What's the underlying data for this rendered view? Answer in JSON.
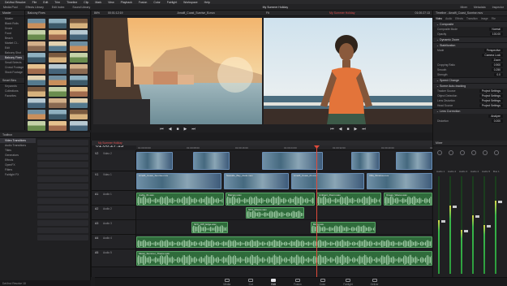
{
  "app": {
    "name": "DaVinci Resolve",
    "project_title": "My Summer Holiday",
    "footer": "DaVinci Resolve 18"
  },
  "menu": [
    "DaVinci Resolve",
    "File",
    "Edit",
    "Trim",
    "Timeline",
    "Clip",
    "Mark",
    "View",
    "Playback",
    "Fusion",
    "Color",
    "Fairlight",
    "Workspace",
    "Help"
  ],
  "toolbar": {
    "left": [
      "Media Pool",
      "Effects Library",
      "Edit Index",
      "Sound Library"
    ],
    "right": [
      "Mixer",
      "Metadata",
      "Inspector"
    ]
  },
  "media_pool": {
    "title": "Balcony Fixes",
    "sidebar_header": "Master",
    "sidebar_items": [
      "Master",
      "Black Rolls",
      "Drone",
      "Food",
      "Beach",
      "Market Cl...",
      "Edit",
      "Balcony Shot",
      "Balcony Fixes",
      "Small Selects",
      "Crowd Footage",
      "Stock Footage"
    ],
    "smart_bins_header": "Smart Bins",
    "smart_bins": [
      "Keywords",
      "Collections",
      "Favorites"
    ],
    "thumb_count": 30
  },
  "viewer_left": {
    "zoom": "86%",
    "timecode": "00:01:12:19",
    "clip_name": "Amalfi_Coast_Sunrise_B.mov",
    "playhead": "00:01:27:13"
  },
  "viewer_right": {
    "timeline_name": "My Summer Holiday",
    "zoom": "Fit",
    "timecode": "01:00:27:13"
  },
  "inspector": {
    "clip_name": "Timeline - Amalfi_Coast_Sunrise.mov",
    "tabs": [
      "Video",
      "Audio",
      "Effects",
      "Transition",
      "Image",
      "File"
    ],
    "sections": [
      {
        "title": "Composite",
        "rows": [
          [
            "Composite Mode",
            "Normal"
          ],
          [
            "Opacity",
            "100.00"
          ]
        ]
      },
      {
        "title": "Dynamic Zoom",
        "rows": []
      },
      {
        "title": "Stabilization",
        "rows": [
          [
            "Mode",
            "Perspective"
          ],
          [
            "",
            "Camera Lock"
          ],
          [
            "",
            "Zoom"
          ],
          [
            "Cropping Ratio",
            "0.900"
          ],
          [
            "Smooth",
            "0.250"
          ],
          [
            "Strength",
            "0.0"
          ]
        ]
      },
      {
        "title": "Speed Change",
        "rows": []
      },
      {
        "title": "Scene Auto-tracking",
        "rows": [
          [
            "Tracker Source",
            "Project Settings"
          ],
          [
            "Object Detection",
            "Project Settings"
          ],
          [
            "Lens Distortion",
            "Project Settings"
          ],
          [
            "Head Source",
            "Project Settings"
          ]
        ]
      },
      {
        "title": "Lens Correction",
        "rows": [
          [
            "",
            "Analyze"
          ],
          [
            "Distortion",
            "0.000"
          ]
        ]
      }
    ]
  },
  "timeline": {
    "timecode": "01:00:27:13",
    "name": "My Summer Holiday",
    "ruler": [
      "01:00:00:00",
      "01:00:08:00",
      "01:00:16:00",
      "01:00:24:00",
      "01:00:32:00",
      "01:00:40:00",
      "01:00:48:00"
    ],
    "video_tracks": [
      {
        "id": "V2",
        "name": "Video 2"
      },
      {
        "id": "V1",
        "name": "Video 1"
      }
    ],
    "audio_tracks": [
      {
        "id": "A1",
        "name": "Audio 1",
        "level": "2.0"
      },
      {
        "id": "A2",
        "name": "Audio 2",
        "level": "2.0"
      },
      {
        "id": "A3",
        "name": "Audio 3",
        "level": "2.0"
      },
      {
        "id": "A4",
        "name": "Audio 4",
        "level": "2.0"
      },
      {
        "id": "A5",
        "name": "Audio 5",
        "level": "2.0"
      }
    ],
    "clips": {
      "v1": [
        "Amalfi_Coast_Sunrise.mov",
        "Seaside_Bay_Dusk.mov",
        "Amalfi_Coast_01.mov",
        "Villa_Window.mov"
      ],
      "a1": [
        "Audio_01.wav",
        "Balcony.wav",
        "Ambient_Room.wav",
        "Ocean_Waves.wav"
      ],
      "a2": [
        "SFX_Waves.wav"
      ],
      "a3": [
        "SFX_Cliff_Edge.wav",
        "Birds.wav"
      ],
      "a5": [
        "Music_Summer_Theme.wav"
      ]
    }
  },
  "effects_panel": {
    "title": "Toolbox",
    "items": [
      "Video Transitions",
      "Audio Transitions",
      "Titles",
      "Generators",
      "Effects",
      "OpenFX",
      "Filters",
      "Fairlight FX"
    ]
  },
  "mixer": {
    "title": "Mixer",
    "channels": [
      "Audio 1",
      "Audio 2",
      "Audio 3",
      "Audio 4",
      "Audio 5",
      "Bus 1"
    ],
    "levels": [
      0.55,
      0.7,
      0.45,
      0.6,
      0.5,
      0.75
    ]
  },
  "pages": [
    "Media",
    "Cut",
    "Edit",
    "Fusion",
    "Color",
    "Fairlight",
    "Deliver"
  ],
  "active_page": "Edit",
  "colors": {
    "accent": "#e04a3a",
    "video_clip": "#3e5b7a",
    "audio_clip": "#2f6b3b"
  }
}
